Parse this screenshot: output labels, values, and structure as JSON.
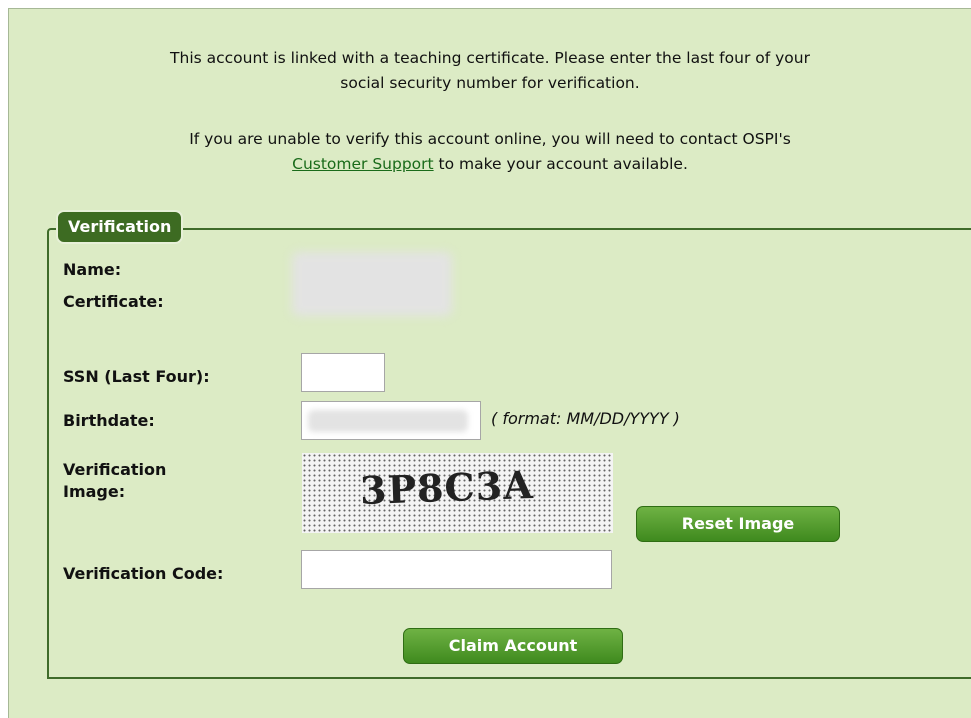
{
  "intro": {
    "line1": "This account is linked with a teaching certificate. Please enter the last four of your",
    "line2": "social security number for verification.",
    "line3": "If you are unable to verify this account online, you will need to contact OSPI's",
    "support_link": "Customer Support",
    "line4_suffix": " to make your account available."
  },
  "form": {
    "legend": "Verification",
    "name_label": "Name:",
    "certificate_label": "Certificate:",
    "ssn_label": "SSN (Last Four):",
    "ssn_value": "",
    "birthdate_label": "Birthdate:",
    "birthdate_format": "( format: MM/DD/YYYY )",
    "verif_image_label_1": "Verification",
    "verif_image_label_2": "Image:",
    "captcha_text": "3P8C3A",
    "reset_button": "Reset Image",
    "verif_code_label": "Verification Code:",
    "verif_code_value": "",
    "claim_button": "Claim Account"
  },
  "colors": {
    "panel_bg": "#dcebc5",
    "legend_bg": "#3d6b22",
    "button_green": "#4f9a2a",
    "link": "#1a6b1a"
  }
}
